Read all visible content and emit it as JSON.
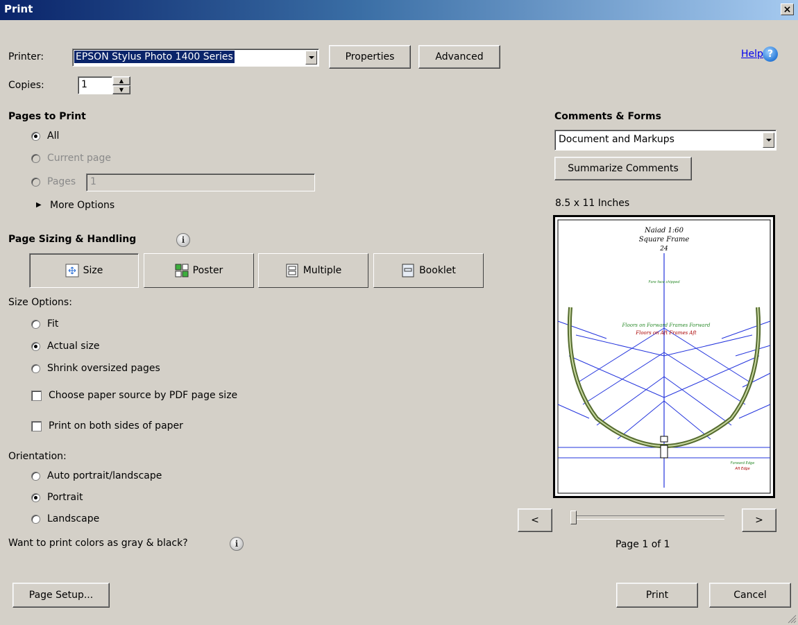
{
  "window": {
    "title": "Print",
    "close_glyph": "×"
  },
  "printer": {
    "label": "Printer:",
    "selected": "EPSON Stylus Photo 1400 Series",
    "properties_button": "Properties",
    "advanced_button": "Advanced"
  },
  "help": {
    "link": "Help",
    "icon": "question-icon"
  },
  "copies": {
    "label": "Copies:",
    "value": "1"
  },
  "pages_to_print": {
    "heading": "Pages to Print",
    "all": "All",
    "current_page": "Current page",
    "pages": "Pages",
    "pages_value": "1",
    "selected": "all",
    "more_options": "More Options"
  },
  "page_sizing": {
    "heading": "Page Sizing & Handling",
    "tabs": [
      {
        "label": "Size",
        "icon": "size-icon",
        "active": true
      },
      {
        "label": "Poster",
        "icon": "poster-icon",
        "active": false
      },
      {
        "label": "Multiple",
        "icon": "multiple-icon",
        "active": false
      },
      {
        "label": "Booklet",
        "icon": "booklet-icon",
        "active": false
      }
    ],
    "size_options_label": "Size Options:",
    "fit": "Fit",
    "actual_size": "Actual size",
    "shrink": "Shrink oversized pages",
    "selected": "actual_size",
    "choose_paper_source": "Choose paper source by PDF page size",
    "choose_paper_checked": false,
    "both_sides": "Print on both sides of paper",
    "both_sides_checked": false
  },
  "orientation": {
    "label": "Orientation:",
    "auto": "Auto portrait/landscape",
    "portrait": "Portrait",
    "landscape": "Landscape",
    "selected": "portrait"
  },
  "gray_question": "Want to print colors as gray & black?",
  "comments_forms": {
    "heading": "Comments & Forms",
    "selected": "Document and Markups",
    "summarize_button": "Summarize Comments"
  },
  "preview": {
    "paper_size": "8.5 x 11 Inches",
    "page_title_line1": "Naiad 1:60",
    "page_title_line2": "Square Frame",
    "page_title_line3": "24",
    "annotation_top": "Fore face chipped",
    "annotation_forward": "Floors on Forward Frames Forward",
    "annotation_aft": "Floors on Aft Frames Aft",
    "annotation_edge1": "Forward Edge",
    "annotation_edge2": "Aft Edge",
    "prev_button": "<",
    "next_button": ">",
    "page_indicator": "Page 1 of 1",
    "slider_position": 0
  },
  "footer": {
    "page_setup_button": "Page Setup...",
    "print_button": "Print",
    "cancel_button": "Cancel"
  },
  "colors": {
    "title_gradient_start": "#0a246a",
    "title_gradient_end": "#a6caf0",
    "dialog_bg": "#d4d0c8",
    "preview_line_blue": "#2233dd",
    "preview_hull_green": "#556b2f"
  }
}
